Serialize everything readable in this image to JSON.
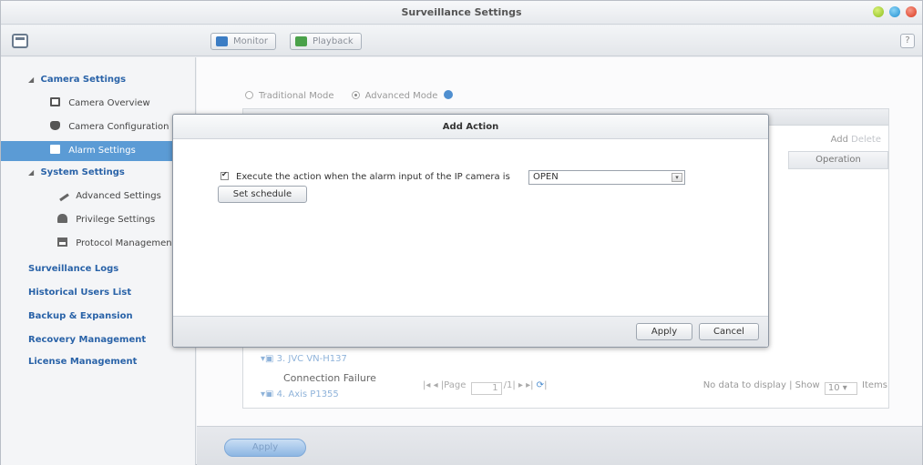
{
  "window": {
    "title": "Surveillance Settings"
  },
  "toolbar": {
    "monitor_label": "Monitor",
    "playback_label": "Playback",
    "help_label": "?"
  },
  "sidebar": {
    "camera_settings": "Camera Settings",
    "camera_overview": "Camera Overview",
    "camera_configuration": "Camera Configuration",
    "alarm_settings": "Alarm Settings",
    "system_settings": "System Settings",
    "advanced_settings": "Advanced Settings",
    "privilege_settings": "Privilege Settings",
    "protocol_management": "Protocol Management",
    "surveillance_logs": "Surveillance Logs",
    "historical_users_list": "Historical Users List",
    "backup_expansion": "Backup & Expansion",
    "recovery_management": "Recovery Management",
    "license_management": "License Management"
  },
  "main": {
    "traditional_mode": "Traditional Mode",
    "advanced_mode": "Advanced Mode",
    "add_label": "Add",
    "delete_label": "Delete",
    "operation_header": "Operation",
    "tree_item_3": "3. JVC VN-H137",
    "tree_item_3_status": "Connection Failure",
    "tree_item_4": "4. Axis P1355",
    "pager_page_label": "Page",
    "pager_page_value": "1",
    "pager_total": "/1",
    "no_data": "No data to display",
    "show_label": "Show",
    "show_value": "10",
    "items_label": "Items",
    "apply_label": "Apply"
  },
  "modal": {
    "title": "Add Action",
    "execute_text": "Execute the action when the alarm input of the IP camera is",
    "alarm_state_value": "OPEN",
    "set_schedule_label": "Set schedule",
    "apply_label": "Apply",
    "cancel_label": "Cancel"
  },
  "colors": {
    "sidebar_group_text": "#2a63a8",
    "selected_item_bg": "#5b9bd5",
    "window_min": "#8cbf1c",
    "window_max": "#1f8fd0",
    "window_close": "#d9361c"
  }
}
